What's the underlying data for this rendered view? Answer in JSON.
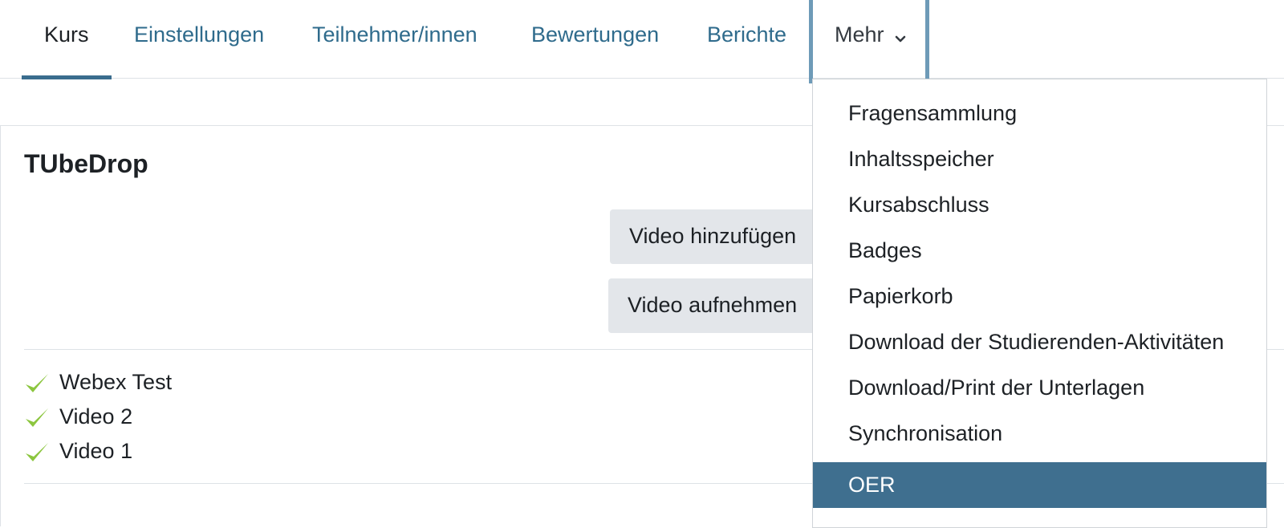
{
  "nav": {
    "tabs": [
      {
        "label": "Kurs"
      },
      {
        "label": "Einstellungen"
      },
      {
        "label": "Teilnehmer/innen"
      },
      {
        "label": "Bewertungen"
      },
      {
        "label": "Berichte"
      },
      {
        "label": "Mehr"
      }
    ],
    "active_tab": "Kurs"
  },
  "block": {
    "title": "TUbeDrop",
    "add_video_label": "Video hinzufügen",
    "record_video_label": "Video aufnehmen",
    "videos": [
      {
        "title": "Webex Test",
        "status_icon": "check-icon"
      },
      {
        "title": "Video 2",
        "status_icon": "check-icon"
      },
      {
        "title": "Video 1",
        "status_icon": "check-icon"
      }
    ]
  },
  "more_menu": {
    "items": [
      {
        "label": "Fragensammlung"
      },
      {
        "label": "Inhaltsspeicher"
      },
      {
        "label": "Kursabschluss"
      },
      {
        "label": "Badges"
      },
      {
        "label": "Papierkorb"
      },
      {
        "label": "Download der Studierenden-Aktivitäten"
      },
      {
        "label": "Download/Print der Unterlagen"
      },
      {
        "label": "Synchronisation"
      },
      {
        "label": "OER"
      }
    ],
    "highlighted": "OER"
  },
  "colors": {
    "link": "#2f6b8c",
    "accent": "#3f6f8f",
    "check": "#8cc63f",
    "button_bg": "#e3e6ea"
  }
}
